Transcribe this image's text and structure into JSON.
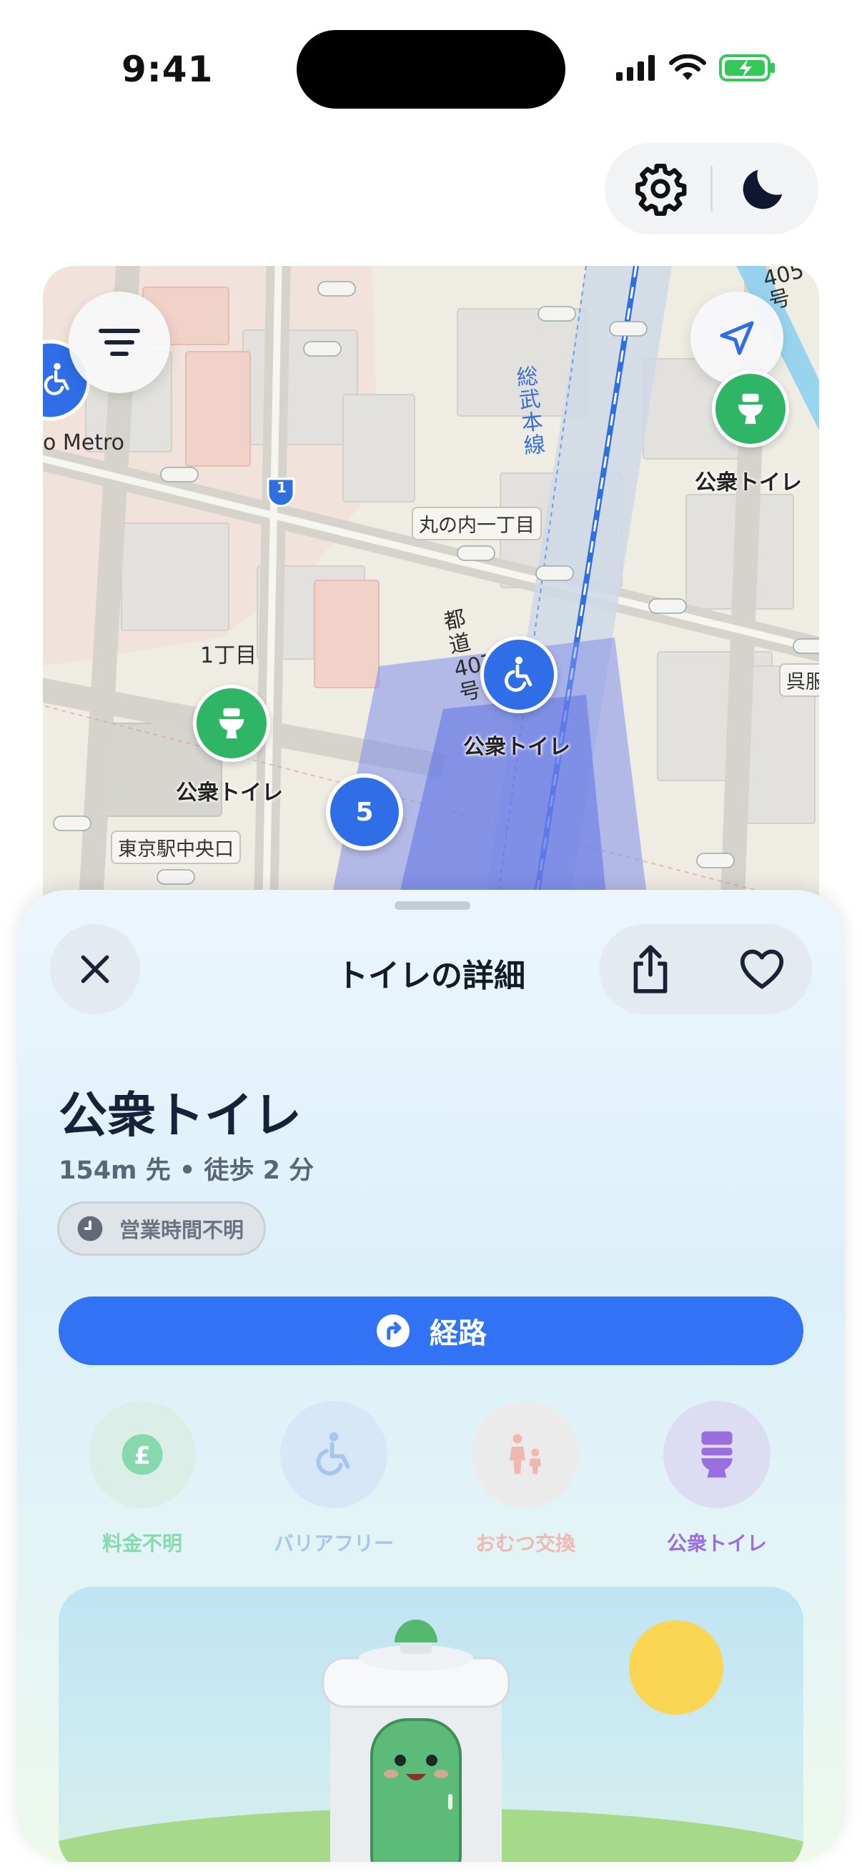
{
  "status_bar": {
    "time": "9:41"
  },
  "top_controls": {
    "settings_icon": "gear-icon",
    "theme_icon": "moon-icon"
  },
  "map": {
    "street_labels": {
      "metro": "o Metro",
      "chome": "1丁目",
      "marunouchi": "丸の内一丁目",
      "tokyo_station": "東京駅中央口",
      "sobu_line": "総武本線",
      "route_407": "都道407号",
      "route_405": "405号",
      "kure": "呉服",
      "route_shield": "1"
    },
    "pins": [
      {
        "type": "toilet",
        "label": "公衆トイレ",
        "color": "#2eb565"
      },
      {
        "type": "wheelchair",
        "label": "公衆トイレ",
        "color": "#2f6ee6"
      },
      {
        "type": "toilet",
        "label": "公衆トイレ",
        "color": "#2eb565"
      }
    ],
    "cluster_count": "5"
  },
  "sheet": {
    "title": "トイレの詳細",
    "place_name": "公衆トイレ",
    "meta": "154m 先 • 徒歩 2 分",
    "hours": "営業時間不明",
    "route_label": "経路",
    "features": [
      {
        "label": "料金不明",
        "icon": "currency-icon",
        "color": "#86d8ad",
        "bg": "#dbefe8"
      },
      {
        "label": "バリアフリー",
        "icon": "wheelchair-icon",
        "color": "#a6c6ef",
        "bg": "#d6e8f7"
      },
      {
        "label": "おむつ交換",
        "icon": "family-icon",
        "color": "#f0b9b0",
        "bg": "#ecebec"
      },
      {
        "label": "公衆トイレ",
        "icon": "toilet-icon",
        "color": "#9b6ee0",
        "bg": "#dcdcf2"
      }
    ]
  },
  "colors": {
    "accent": "#3273f6",
    "green": "#2eb565"
  }
}
